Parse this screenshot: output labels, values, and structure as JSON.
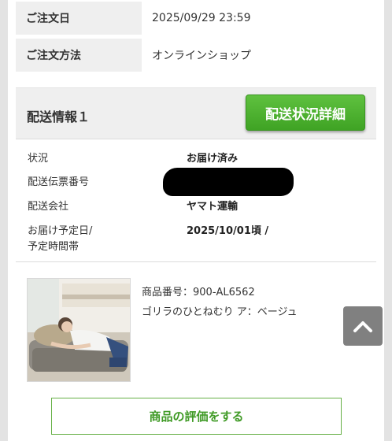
{
  "order": {
    "date_label": "ご注文日",
    "date_value": "2025/09/29 23:59",
    "method_label": "ご注文方法",
    "method_value": "オンラインショップ"
  },
  "delivery": {
    "title": "配送情報１",
    "status_button": "配送状況詳細",
    "status_label": "状況",
    "status_value": "お届け済み",
    "tracking_label": "配送伝票番号",
    "carrier_label": "配送会社",
    "carrier_value": "ヤマト運輸",
    "schedule_label_line1": "お届け予定日/",
    "schedule_label_line2": "予定時間帯",
    "schedule_value": "2025/10/01頃 /"
  },
  "product": {
    "number": "商品番号：900-AL6562",
    "name": "ゴリラのひとねむり ア：ベージュ"
  },
  "review_button": "商品の評価をする",
  "icons": [
    "chevron-up-icon"
  ]
}
